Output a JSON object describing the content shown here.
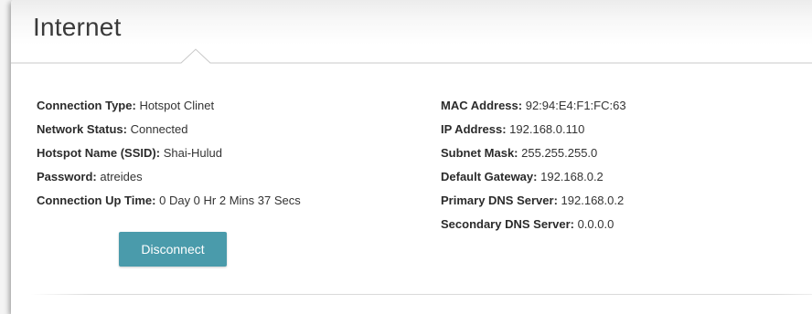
{
  "page": {
    "title": "Internet"
  },
  "left_info": [
    {
      "label": "Connection Type:",
      "value": "Hotspot Clinet"
    },
    {
      "label": "Network Status:",
      "value": "Connected"
    },
    {
      "label": "Hotspot Name (SSID):",
      "value": "Shai-Hulud"
    },
    {
      "label": "Password:",
      "value": "atreides"
    },
    {
      "label": "Connection Up Time:",
      "value": "0 Day 0 Hr 2 Mins 37 Secs"
    }
  ],
  "right_info": [
    {
      "label": "MAC Address:",
      "value": "92:94:E4:F1:FC:63"
    },
    {
      "label": "IP Address:",
      "value": "192.168.0.110"
    },
    {
      "label": "Subnet Mask:",
      "value": "255.255.255.0"
    },
    {
      "label": "Default Gateway:",
      "value": "192.168.0.2"
    },
    {
      "label": "Primary DNS Server:",
      "value": "192.168.0.2"
    },
    {
      "label": "Secondary DNS Server:",
      "value": "0.0.0.0"
    }
  ],
  "actions": {
    "disconnect_label": "Disconnect"
  },
  "colors": {
    "button": "#4a9bab",
    "title": "#3a3a3a",
    "text": "#333333"
  }
}
